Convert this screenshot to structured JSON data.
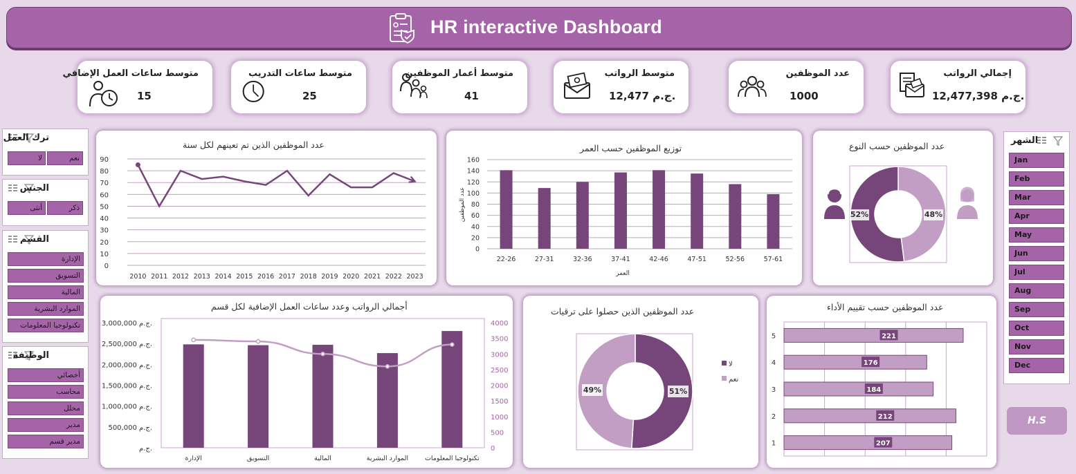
{
  "header": {
    "title": "HR interactive Dashboard"
  },
  "kpis": [
    {
      "label": "إجمالي الرواتب",
      "value": "12,477,398 ج.م.",
      "icon": "salary-documents-icon"
    },
    {
      "label": "عدد الموظفين",
      "value": "1000",
      "icon": "employees-group-icon"
    },
    {
      "label": "متوسط الرواتب",
      "value": "12,477 ج.م.",
      "icon": "money-envelope-icon"
    },
    {
      "label": "متوسط أعمار الموظفين",
      "value": "41",
      "icon": "family-age-icon"
    },
    {
      "label": "متوسط ساعات التدريب",
      "value": "25",
      "icon": "clock-icon"
    },
    {
      "label": "متوسط ساعات العمل الإضافي",
      "value": "15",
      "icon": "worker-clock-icon"
    }
  ],
  "slicers": {
    "attrition": {
      "title": "ترك العمل",
      "items": [
        "نعم",
        "لا"
      ]
    },
    "gender": {
      "title": "الجنس",
      "items": [
        "ذكر",
        "أنثى"
      ]
    },
    "department": {
      "title": "القسم",
      "items": [
        "الإدارة",
        "التسويق",
        "المالية",
        "الموارد البشرية",
        "تكنولوجيا المعلومات"
      ]
    },
    "job": {
      "title": "الوظيفة",
      "items": [
        "أخصائي",
        "محاسب",
        "محلل",
        "مدير",
        "مدير قسم"
      ]
    },
    "month": {
      "title": "الشهر",
      "items": [
        "Jan",
        "Feb",
        "Mar",
        "Apr",
        "May",
        "Jun",
        "Jul",
        "Aug",
        "Sep",
        "Oct",
        "Nov",
        "Dec"
      ]
    }
  },
  "signature": "H.S",
  "colors": {
    "primary": "#a664a8",
    "dark": "#76457a",
    "light": "#c29ec5",
    "background": "#e7d9ea"
  },
  "chart_data": [
    {
      "id": "hires",
      "type": "line",
      "title": "عدد الموظفين الذين تم تعينهم لكل سنة",
      "x": [
        "2010",
        "2011",
        "2012",
        "2013",
        "2014",
        "2015",
        "2016",
        "2017",
        "2018",
        "2019",
        "2020",
        "2021",
        "2022",
        "2023"
      ],
      "values": [
        85,
        50,
        80,
        73,
        75,
        71,
        68,
        80,
        59,
        77,
        66,
        66,
        78,
        71
      ],
      "ylim": [
        0,
        90
      ],
      "yticks": [
        0,
        10,
        20,
        30,
        40,
        50,
        60,
        70,
        80,
        90
      ],
      "grid": true
    },
    {
      "id": "age",
      "type": "bar",
      "title": "توزيع الموظفين حسب العمر",
      "xlabel": "العمر",
      "ylabel": "عدد الموظفين",
      "categories": [
        "22-26",
        "27-31",
        "32-36",
        "37-41",
        "42-46",
        "47-51",
        "52-56",
        "57-61"
      ],
      "values": [
        141,
        109,
        120,
        137,
        141,
        135,
        116,
        98
      ],
      "ylim": [
        0,
        160
      ],
      "yticks": [
        0,
        20,
        40,
        60,
        80,
        100,
        120,
        140,
        160
      ],
      "grid": true
    },
    {
      "id": "gender",
      "type": "pie",
      "title": "عدد الموظفين حسب النوع",
      "labels": [
        "52%",
        "48%"
      ],
      "values": [
        52,
        48
      ]
    },
    {
      "id": "salary",
      "type": "bar",
      "title": "أجمالي الرواتب وعدد ساعات العمل الإضافية لكل قسم",
      "categories": [
        "الإدارة",
        "التسويق",
        "المالية",
        "الموارد البشرية",
        "تكنولوجيا المعلومات"
      ],
      "series": [
        {
          "values": [
            2480000,
            2460000,
            2470000,
            2270000,
            2800000
          ]
        },
        {
          "values": [
            3450,
            3400,
            3000,
            2600,
            3300
          ]
        }
      ],
      "ylim": [
        0,
        3000000
      ],
      "yticks": [
        "ج.م.",
        "500,000 ج.م.",
        "1,000,000 ج.م.",
        "1,500,000 ج.م.",
        "2,000,000 ج.م.",
        "2,500,000 ج.م.",
        "3,000,000 ج.م."
      ],
      "y2lim": [
        0,
        4000
      ],
      "y2ticks": [
        "0",
        "500",
        "1000",
        "1500",
        "2000",
        "2500",
        "3000",
        "3500",
        "4000"
      ]
    },
    {
      "id": "promotion",
      "type": "pie",
      "title": "عدد الموظفين الذين حصلوا على ترقيات",
      "labels": [
        "51%",
        "49%"
      ],
      "values": [
        51,
        49
      ],
      "legend": [
        "لا",
        "نعم"
      ],
      "legend_position": "right"
    },
    {
      "id": "rating",
      "type": "bar",
      "title": "عدد الموظفين حسب تقييم الأداء",
      "categories": [
        "5",
        "4",
        "3",
        "2",
        "1"
      ],
      "values": [
        221,
        176,
        184,
        212,
        207
      ],
      "labels": [
        "221",
        "176",
        "184",
        "212",
        "207"
      ],
      "xlim": [
        0,
        250
      ],
      "grid": true
    }
  ]
}
